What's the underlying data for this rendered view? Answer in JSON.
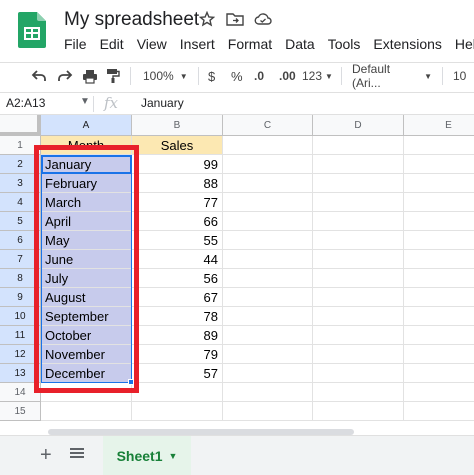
{
  "app": {
    "doc_title": "My spreadsheet",
    "menu": [
      "File",
      "Edit",
      "View",
      "Insert",
      "Format",
      "Data",
      "Tools",
      "Extensions",
      "Help"
    ],
    "title_icons": [
      "star-icon",
      "move-to-folder-icon",
      "cloud-status-icon"
    ]
  },
  "toolbar": {
    "zoom": "100%",
    "currency": "$",
    "percent": "%",
    "decrease_decimal": ".0",
    "increase_decimal": ".00",
    "more_formats": "123",
    "font": "Default (Ari...",
    "font_size": "10"
  },
  "formula_bar": {
    "name_box": "A2:A13",
    "fx": "fx",
    "value": "January"
  },
  "grid": {
    "columns": [
      "A",
      "B",
      "C",
      "D",
      "E"
    ],
    "rows": [
      "1",
      "2",
      "3",
      "4",
      "5",
      "6",
      "7",
      "8",
      "9",
      "10",
      "11",
      "12",
      "13",
      "14",
      "15"
    ],
    "header_row": {
      "a": "Month",
      "b": "Sales"
    },
    "data": [
      {
        "month": "January",
        "sales": "99"
      },
      {
        "month": "February",
        "sales": "88"
      },
      {
        "month": "March",
        "sales": "77"
      },
      {
        "month": "April",
        "sales": "66"
      },
      {
        "month": "May",
        "sales": "55"
      },
      {
        "month": "June",
        "sales": "44"
      },
      {
        "month": "July",
        "sales": "56"
      },
      {
        "month": "August",
        "sales": "67"
      },
      {
        "month": "September",
        "sales": "78"
      },
      {
        "month": "October",
        "sales": "89"
      },
      {
        "month": "November",
        "sales": "79"
      },
      {
        "month": "December",
        "sales": "57"
      }
    ],
    "selection": "A2:A13",
    "highlight_color": "#e8202a"
  },
  "sheets": {
    "active": "Sheet1"
  },
  "colors": {
    "accent": "#1a73e8",
    "selection_fill": "#c7cbec",
    "header_fill": "#fce8b2",
    "sheet_tab_text": "#188038"
  }
}
